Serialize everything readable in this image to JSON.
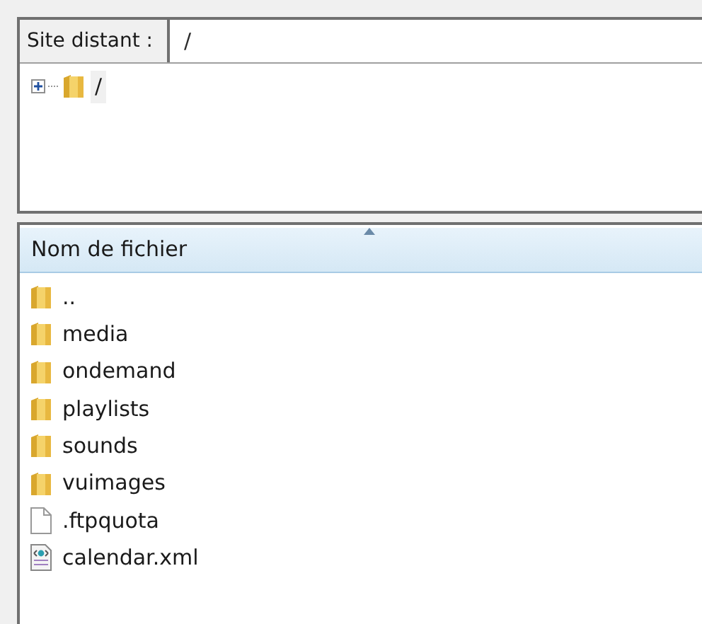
{
  "remote_site": {
    "label": "Site distant :",
    "path": "/"
  },
  "tree": [
    {
      "name": "/",
      "expanded": false
    }
  ],
  "file_list": {
    "columns": [
      {
        "label": "Nom de fichier",
        "sorted": true
      }
    ],
    "rows": [
      {
        "name": "..",
        "kind": "folder"
      },
      {
        "name": "media",
        "kind": "folder"
      },
      {
        "name": "ondemand",
        "kind": "folder"
      },
      {
        "name": "playlists",
        "kind": "folder"
      },
      {
        "name": "sounds",
        "kind": "folder"
      },
      {
        "name": "vuimages",
        "kind": "folder"
      },
      {
        "name": ".ftpquota",
        "kind": "file"
      },
      {
        "name": "calendar.xml",
        "kind": "xml"
      }
    ]
  }
}
